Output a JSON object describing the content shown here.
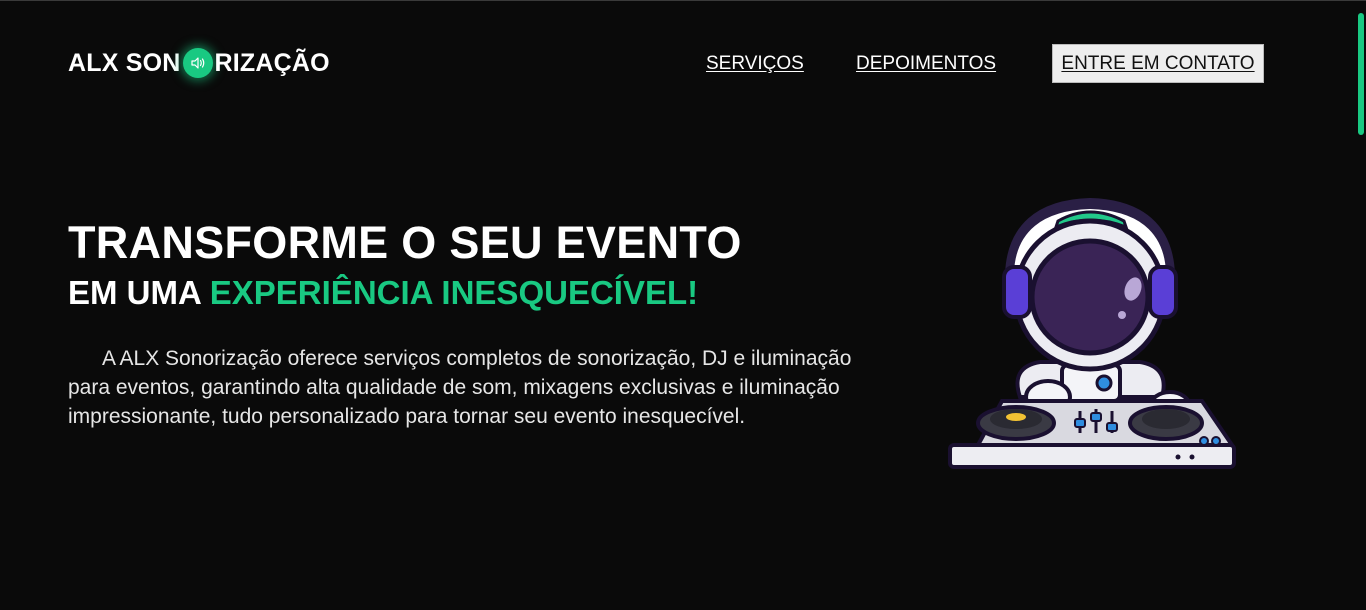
{
  "header": {
    "logo_before": "ALX SON",
    "logo_after": "RIZAÇÃO",
    "logo_icon": "speaker-icon",
    "nav": {
      "services": "SERVIÇOS",
      "testimonials": "DEPOIMENTOS",
      "contact": "ENTRE EM CONTATO"
    }
  },
  "hero": {
    "title": "TRANSFORME O SEU EVENTO",
    "subtitle_prefix": "EM UMA ",
    "subtitle_accent": "EXPERIÊNCIA INESQUECÍVEL!",
    "description": "A ALX Sonorização oferece serviços completos de sonorização, DJ e iluminação para eventos, garantindo alta qualidade de som, mixagens exclusivas e iluminação impressionante, tudo personalizado para tornar seu evento inesquecível."
  },
  "colors": {
    "background": "#0a0a0a",
    "accent": "#19c982",
    "text": "#ffffff",
    "button_bg": "#eeeeee"
  },
  "illustration": "astronaut-dj-icon"
}
